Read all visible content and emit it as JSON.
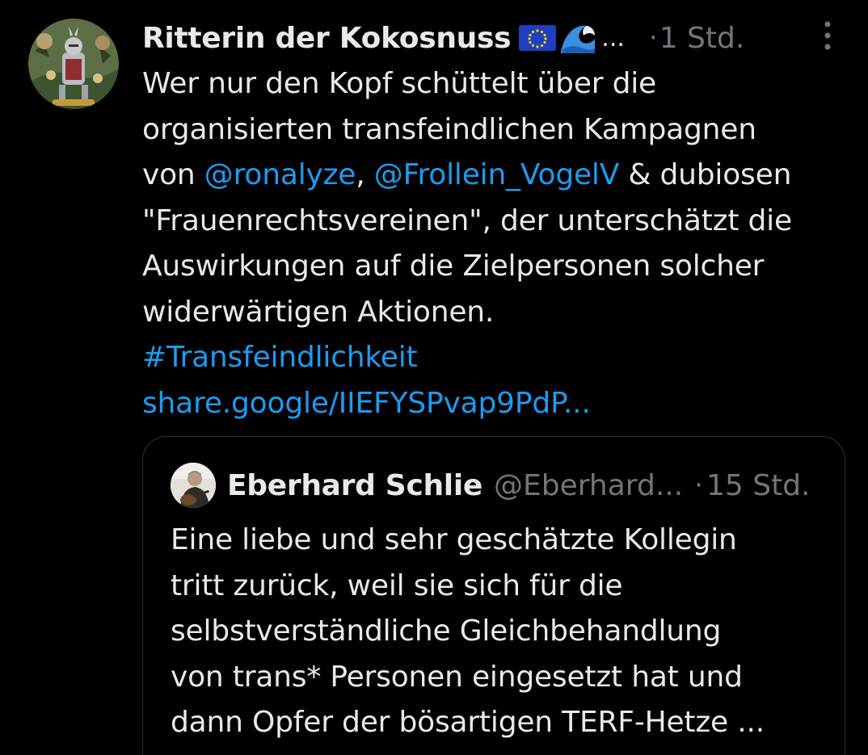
{
  "post": {
    "author": {
      "display_name": "Ritterin der Kokosnuss",
      "emoji": [
        "eu-flag",
        "water-wave"
      ],
      "truncation": "...",
      "dot": "·",
      "time": "1 Std."
    },
    "avatar_icon": "knight-avatar",
    "more_icon": "more-vertical-icon",
    "text": {
      "line1": "Wer nur den Kopf schüttelt über die",
      "line2": "organisierten transfeindlichen Kampagnen",
      "line3_prefix": "von ",
      "mention1": "@ronalyze",
      "line3_comma": ", ",
      "mention2": "@Frollein_VogelV",
      "line3_suffix": " & dubiosen",
      "line4": "\"Frauenrechtsvereinen\", der unterschätzt die",
      "line5": "Auswirkungen auf die Zielpersonen solcher",
      "line6": "widerwärtigen Aktionen.",
      "hashtag": "#Transfeindlichkeit",
      "url": "share.google/IIEFYSPvap9PdP..."
    },
    "colors": {
      "background": "#000000",
      "text": "#e7e9ea",
      "muted": "#71767b",
      "link": "#1d9bf0",
      "border": "#2f3336"
    }
  },
  "quote": {
    "display_name": "Eberhard Schlie",
    "handle": "@Eberhard...",
    "dot": "·",
    "time": "15 Std.",
    "avatar_icon": "person-with-guitar-avatar",
    "lines": [
      "Eine liebe und sehr geschätzte Kollegin",
      "tritt zurück, weil sie sich für die",
      "selbstverständliche Gleichbehandlung",
      "von trans* Personen eingesetzt hat und",
      "dann Opfer der bösartigen TERF-Hetze ..."
    ]
  }
}
